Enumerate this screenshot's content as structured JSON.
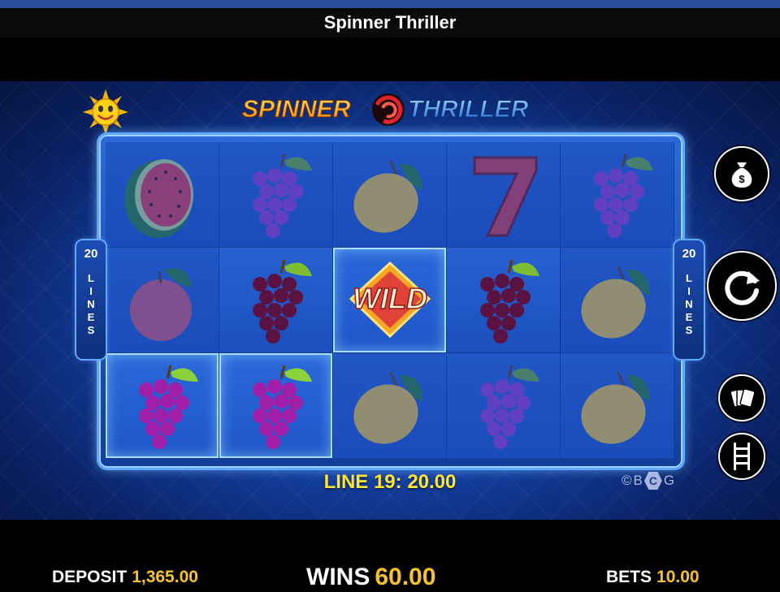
{
  "window": {
    "title": "Spinner Thriller"
  },
  "game": {
    "logo_left": "SPINNER",
    "logo_right": "THRILLER",
    "lines_count": "20",
    "lines_word": "LINES",
    "win_line_message": "LINE 19: 20.00",
    "copyright_symbol": "©",
    "copyright_left": "B",
    "copyright_mid": "C",
    "copyright_right": "G",
    "wild_label": "WILD",
    "reels": [
      [
        "watermelon",
        "grapes",
        "lemon",
        "seven",
        "grapes"
      ],
      [
        "plum",
        "grapes",
        "wild",
        "grapes",
        "lemon"
      ],
      [
        "grapes",
        "grapes",
        "lemon",
        "grapes",
        "lemon"
      ]
    ]
  },
  "controls": {
    "cash_icon": "money-bag-icon",
    "spin_icon": "refresh-icon",
    "gamble_icon": "cards-icon",
    "ladder_icon": "ladder-icon"
  },
  "footer": {
    "deposit_label": "DEPOSIT",
    "deposit_value": "1,365.00",
    "wins_label": "WINS",
    "wins_value": "60.00",
    "bets_label": "BETS",
    "bets_value": "10.00"
  },
  "colors": {
    "accent_yellow": "#f7c22b",
    "message_yellow": "#ffe433",
    "reel_blue": "#1c4fbe"
  }
}
